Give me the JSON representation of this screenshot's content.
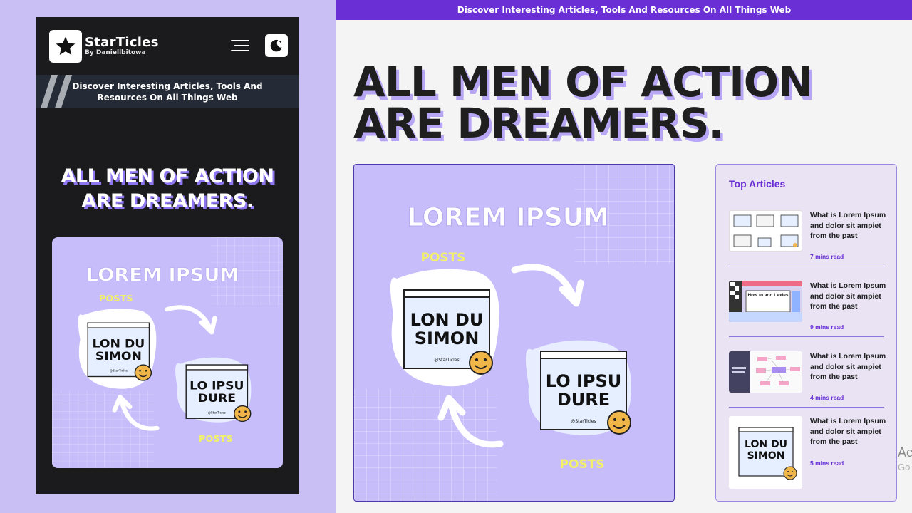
{
  "mobile": {
    "logo": {
      "title": "StarTicles",
      "subtitle": "By Daniellbitowa",
      "icon": "star-icon"
    },
    "menu_icon": "hamburger-menu-icon",
    "theme_icon": "moon-icon",
    "banner_text": "Discover Interesting Articles, Tools And Resources On All Things Web",
    "hero": {
      "line1": "ALL MEN OF ACTION",
      "line2": "ARE DREAMERS."
    },
    "card": {
      "title": "LOREM IPSUM",
      "posts_label_top": "POSTS",
      "posts_label_bottom": "POSTS",
      "window1": {
        "line1": "LON DU",
        "line2": "SIMON",
        "footer": "@StarTicles"
      },
      "window2": {
        "line1": "LO IPSU",
        "line2": "DURE",
        "footer": "@StarTicles"
      }
    }
  },
  "desktop": {
    "topbar_text": "Discover Interesting Articles, Tools And Resources On All Things Web",
    "hero": {
      "line1": "ALL MEN OF ACTION",
      "line2": "ARE DREAMERS."
    },
    "card": {
      "title": "LOREM IPSUM",
      "posts_label_top": "POSTS",
      "posts_label_bottom": "POSTS",
      "window1": {
        "line1": "LON DU",
        "line2": "SIMON",
        "footer": "@StarTicles"
      },
      "window2": {
        "line1": "LO IPSU",
        "line2": "DURE",
        "footer": "@StarTicles"
      }
    },
    "sidebar": {
      "title": "Top Articles",
      "articles": [
        {
          "title": "What is Lorem Ipsum and dolor sit ampiet from the past",
          "read_time": "7 mins read"
        },
        {
          "title": "What is Lorem Ipsum and dolor sit ampiet from the past",
          "read_time": "9 mins read",
          "thumb_text": "How to add Lexies"
        },
        {
          "title": "What is Lorem Ipsum and dolor sit ampiet from the past",
          "read_time": "4 mins read"
        },
        {
          "title": "What is Lorem Ipsum and dolor sit ampiet from the past",
          "read_time": "5 mins read",
          "thumb_line1": "LON DU",
          "thumb_line2": "SIMON"
        }
      ]
    },
    "ad_fragment": {
      "line1": "Ac",
      "line2": "Go"
    }
  },
  "colors": {
    "brand_purple": "#6a2fd5",
    "lavender": "#c7bdfa",
    "hero_shadow": "#b7a6f4",
    "posts_yellow": "#f2f06b"
  }
}
